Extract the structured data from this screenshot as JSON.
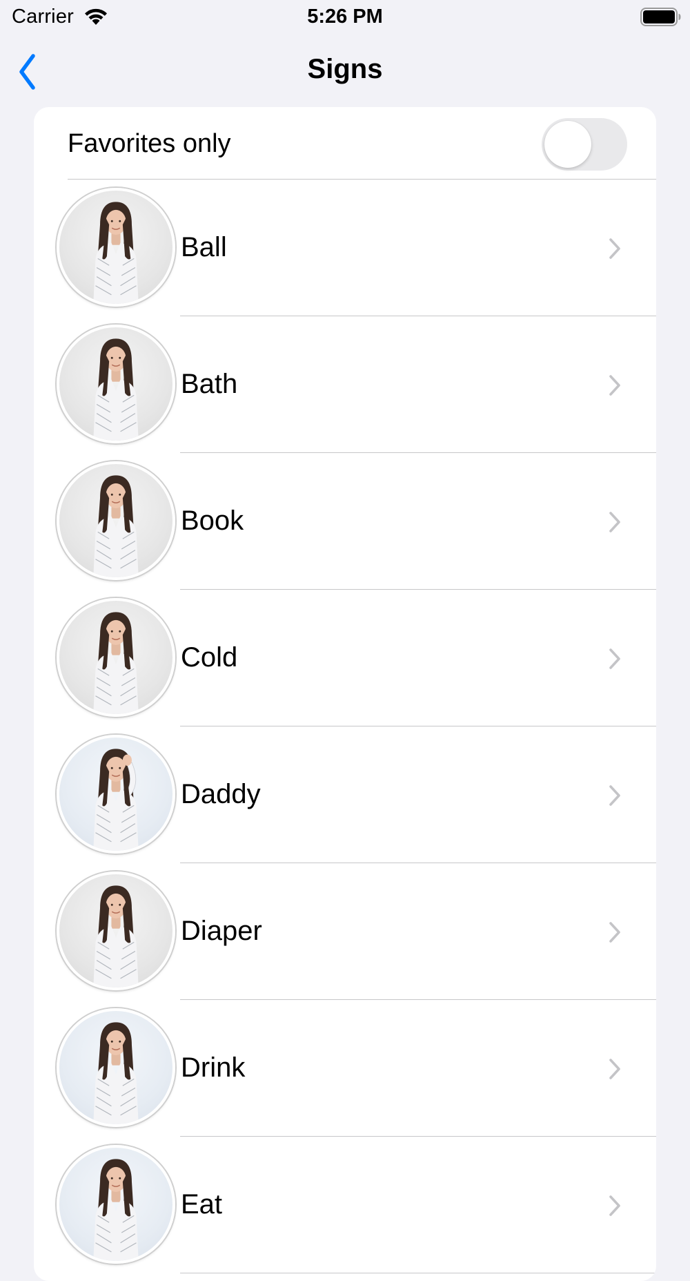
{
  "status_bar": {
    "carrier": "Carrier",
    "time": "5:26 PM"
  },
  "nav": {
    "title": "Signs",
    "back_icon": "chevron-left-icon",
    "accent_color": "#007aff"
  },
  "favorites": {
    "label": "Favorites only",
    "toggle_on": false
  },
  "signs": [
    {
      "label": "Ball",
      "pose": "arms-down"
    },
    {
      "label": "Bath",
      "pose": "arms-down"
    },
    {
      "label": "Book",
      "pose": "arms-down"
    },
    {
      "label": "Cold",
      "pose": "arms-down"
    },
    {
      "label": "Daddy",
      "pose": "hand-to-forehead"
    },
    {
      "label": "Diaper",
      "pose": "arms-down"
    },
    {
      "label": "Drink",
      "pose": "arms-down"
    },
    {
      "label": "Eat",
      "pose": "arms-down"
    }
  ]
}
